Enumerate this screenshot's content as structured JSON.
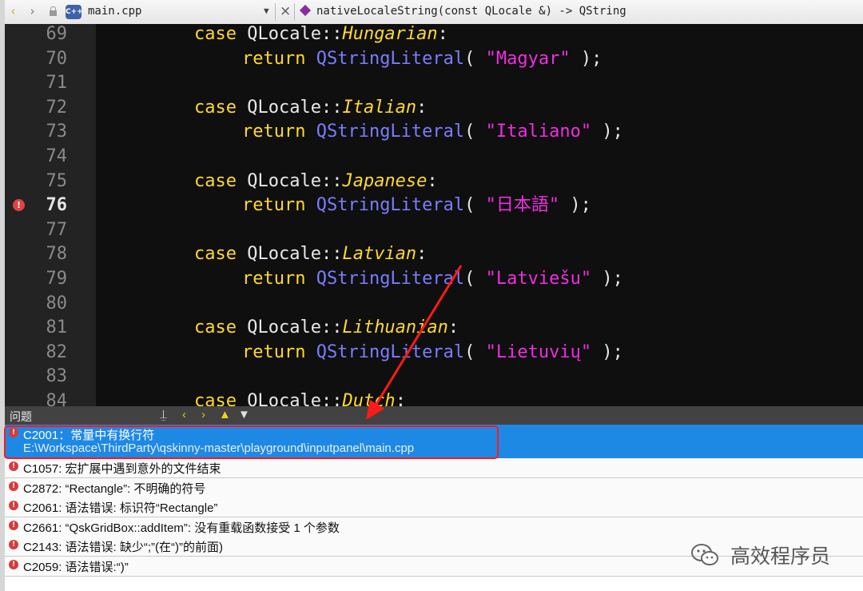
{
  "toolbar": {
    "back_glyph": "‹",
    "forward_glyph": "›",
    "file_icon_text": "C++",
    "file_name": "main.cpp",
    "dropdown_glyph": "▼",
    "close_glyph": "×",
    "symbol": "nativeLocaleString(const QLocale &) -> QString"
  },
  "editor": {
    "lines": [
      {
        "num": "69",
        "tokens": {
          "case": "case ",
          "cls": "QLocale",
          "dc": "::",
          "enum": "Hungarian",
          "colon": ":"
        }
      },
      {
        "num": "70",
        "tokens": {
          "ret": "return ",
          "fn": "QStringLiteral",
          "open": "( ",
          "str": "\"Magyar\"",
          "close": " );"
        }
      },
      {
        "num": "71"
      },
      {
        "num": "72",
        "tokens": {
          "case": "case ",
          "cls": "QLocale",
          "dc": "::",
          "enum": "Italian",
          "colon": ":"
        }
      },
      {
        "num": "73",
        "tokens": {
          "ret": "return ",
          "fn": "QStringLiteral",
          "open": "( ",
          "str": "\"Italiano\"",
          "close": " );"
        }
      },
      {
        "num": "74"
      },
      {
        "num": "75",
        "tokens": {
          "case": "case ",
          "cls": "QLocale",
          "dc": "::",
          "enum": "Japanese",
          "colon": ":"
        }
      },
      {
        "num": "76",
        "tokens": {
          "ret": "return ",
          "fn": "QStringLiteral",
          "open": "( ",
          "str": "\"日本語\"",
          "close": " );"
        }
      },
      {
        "num": "77"
      },
      {
        "num": "78",
        "tokens": {
          "case": "case ",
          "cls": "QLocale",
          "dc": "::",
          "enum": "Latvian",
          "colon": ":"
        }
      },
      {
        "num": "79",
        "tokens": {
          "ret": "return ",
          "fn": "QStringLiteral",
          "open": "( ",
          "str": "\"Latviešu\"",
          "close": " );"
        }
      },
      {
        "num": "80"
      },
      {
        "num": "81",
        "tokens": {
          "case": "case ",
          "cls": "QLocale",
          "dc": "::",
          "enum": "Lithuanian",
          "colon": ":"
        }
      },
      {
        "num": "82",
        "tokens": {
          "ret": "return ",
          "fn": "QStringLiteral",
          "open": "( ",
          "str": "\"Lietuvių\"",
          "close": " );"
        }
      },
      {
        "num": "83"
      },
      {
        "num": "84",
        "tokens": {
          "case": "case ",
          "cls": "QLocale",
          "dc": "::",
          "enum": "Dutch",
          "colon": ":"
        }
      }
    ],
    "error_marker": "!"
  },
  "issues_pane": {
    "title": "问题",
    "tools": {
      "filter_build": "⍊",
      "prev": "‹",
      "next": "›",
      "warning": "▲",
      "filter": "▼"
    },
    "error_glyph": "!",
    "selected": {
      "message": "C2001：常量中有换行符",
      "path": "E:\\Workspace\\ThirdParty\\qskinny-master\\playground\\inputpanel\\main.cpp"
    },
    "items": [
      "C1057: 宏扩展中遇到意外的文件结束",
      "C2872: “Rectangle”: 不明确的符号",
      "C2061: 语法错误: 标识符“Rectangle”",
      "C2661: “QskGridBox::addItem”: 没有重载函数接受 1 个参数",
      "C2143: 语法错误: 缺少“;”(在“)”的前面)",
      "C2059: 语法错误:“)”"
    ]
  },
  "watermark": {
    "text": "高效程序员"
  },
  "colors": {
    "editor_bg": "#0f0f0f",
    "keyword": "#ffd92e",
    "function": "#7c7cff",
    "string": "#f02ee0",
    "selection": "#1e88e5",
    "error": "#e34242",
    "annotation": "#ff1a1a"
  }
}
